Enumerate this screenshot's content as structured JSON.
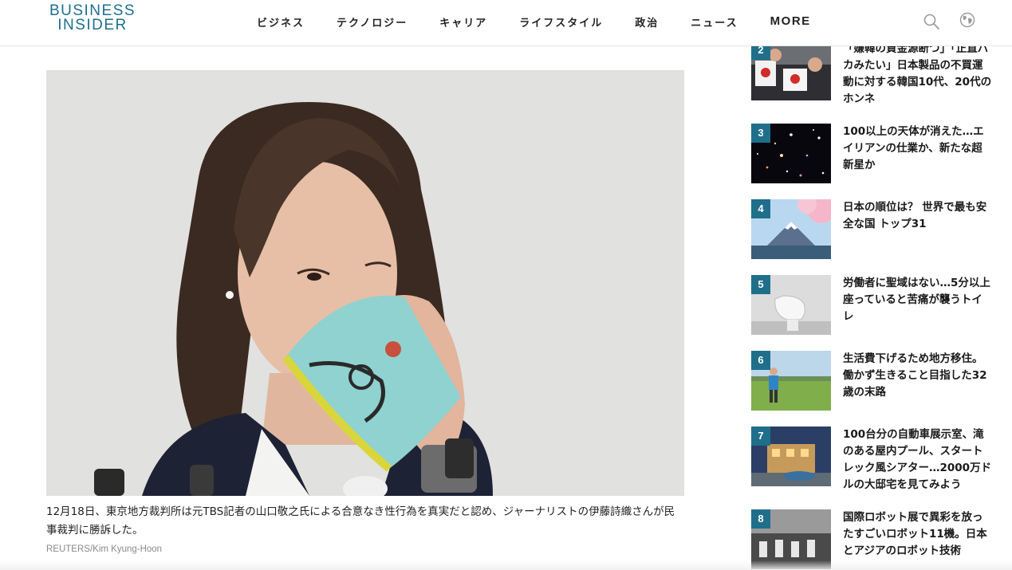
{
  "header": {
    "logo_line1": "BUSINESS",
    "logo_line2": "INSIDER",
    "nav": [
      "ビジネス",
      "テクノロジー",
      "キャリア",
      "ライフスタイル",
      "政治",
      "ニュース",
      "MORE"
    ]
  },
  "article": {
    "caption": "12月18日、東京地方裁判所は元TBS記者の山口敬之氏による合意なき性行為を真実だと認め、ジャーナリストの伊藤詩織さんが民事裁判に勝訴した。",
    "credit": "REUTERS/Kim Kyung-Hoon"
  },
  "sidebar": {
    "items": [
      {
        "rank": "2",
        "title": "「嫌韓の資金源断つ」「正直バカみたい」日本製品の不買運動に対する韓国10代、20代のホンネ"
      },
      {
        "rank": "3",
        "title": "100以上の天体が消えた…エイリアンの仕業か、新たな超新星か"
      },
      {
        "rank": "4",
        "title": "日本の順位は？ 世界で最も安全な国 トップ31"
      },
      {
        "rank": "5",
        "title": "労働者に聖域はない…5分以上座っていると苦痛が襲うトイレ"
      },
      {
        "rank": "6",
        "title": "生活費下げるため地方移住。働かず生きること目指した32歳の末路"
      },
      {
        "rank": "7",
        "title": "100台分の自動車展示室、滝のある屋内プール、スタートレック風シアター…2000万ドルの大邸宅を見てみよう"
      },
      {
        "rank": "8",
        "title": "国際ロボット展で異彩を放ったすごいロボット11機。日本とアジアのロボット技術"
      }
    ]
  },
  "colors": {
    "brand": "#1f6f8b"
  }
}
